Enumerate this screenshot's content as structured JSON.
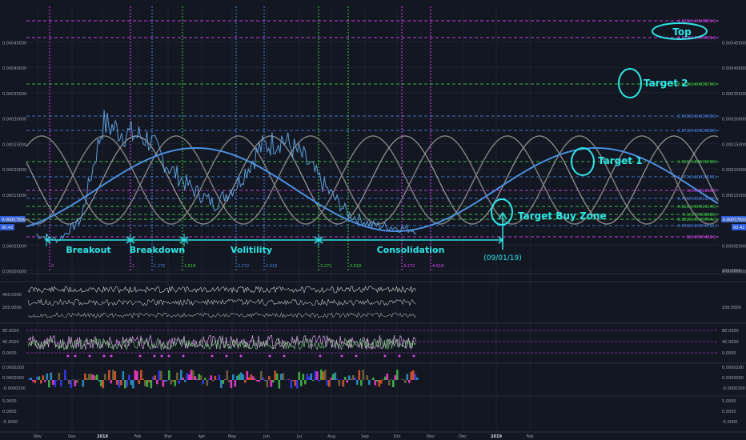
{
  "chart_data": [
    {
      "type": "line",
      "panel": "price",
      "series": [
        {
          "values": [
            7e-05,
            6e-05,
            0.0001,
            0.00029,
            0.00027,
            0.00026,
            0.0002,
            0.00016,
            0.00013,
            0.00017,
            0.00024,
            0.00026,
            0.00022,
            0.00016,
            0.00011,
            9e-05,
            8.5e-05,
            8e-05
          ]
        }
      ],
      "ylim": [
        0,
        0.00052
      ],
      "y_ticks": [
        "0.00000000",
        "0.00005000",
        "0.00010000",
        "0.00015000",
        "0.00020000",
        "0.00025000",
        "0.00030000",
        "0.00035000",
        "0.00040000",
        "0.00045000"
      ],
      "x_ticks": [
        "Nov",
        "Dec",
        "2018",
        "Feb",
        "Mar",
        "Apr",
        "May",
        "Jun",
        "Jul",
        "Aug",
        "Sep",
        "Oct",
        "Nov",
        "Dec",
        "2019",
        "Feb"
      ],
      "price_labels": [
        "0.00007650",
        "00:42"
      ],
      "fib_labels": [
        "4.618(0.00048614)",
        "4.272(0.00045614)",
        "3.618(0.00035756)",
        "2.618(0.00029630)",
        "2.272(0.00026828)",
        "1.618(0.00021639)",
        "1.272(0.00016591)",
        "1(0.00013658)",
        "0.786(0.00011578)",
        "0.618(0.00010145)",
        "0.5(0.00008883)",
        "0.382(0.00007842)",
        "0.236(0.00006491)",
        "0(0.00004614)"
      ],
      "time_fib_labels": [
        "0",
        "1",
        "1.272",
        "1.618",
        "2.272",
        "2.618",
        "3.272",
        "3.618",
        "4.272",
        "4.618"
      ],
      "annotations": [
        "Top",
        "Target 2",
        "Target 1",
        "Target Buy Zone",
        "Breakout",
        "Breakdown",
        "Volitility",
        "Consolidation",
        "(09/01/19)"
      ]
    },
    {
      "type": "line",
      "panel": "oscillator-1",
      "y_ticks": [
        "400.0000",
        "200.0000"
      ],
      "right_ticks": [
        "300.0000",
        "200.0000"
      ]
    },
    {
      "type": "line",
      "panel": "oscillator-2",
      "y_ticks": [
        "80.0000",
        "40.0000",
        "0.0000"
      ],
      "right_ticks": [
        "80.0000",
        "40.0000",
        "0.0000"
      ]
    },
    {
      "type": "area",
      "panel": "oscillator-3",
      "y_ticks": [
        "0.0000200",
        "0.0000000",
        "-0.0000200"
      ],
      "right_ticks": [
        "0.0000200",
        "0.0000000",
        "-0.0000200"
      ]
    },
    {
      "type": "line",
      "panel": "oscillator-4",
      "y_ticks": [
        "5.0000",
        "0.0000",
        "-5.0000"
      ],
      "right_ticks": [
        "5.0000",
        "0.0000",
        "-5.0000"
      ]
    }
  ],
  "colors": {
    "bg": "#131722",
    "price": "#5b9bd5",
    "cyan": "#2ee6e6",
    "magenta": "#d946ef",
    "green": "#3ecf3e",
    "blue": "#4a7fe0",
    "gray": "#8a8a8a"
  }
}
